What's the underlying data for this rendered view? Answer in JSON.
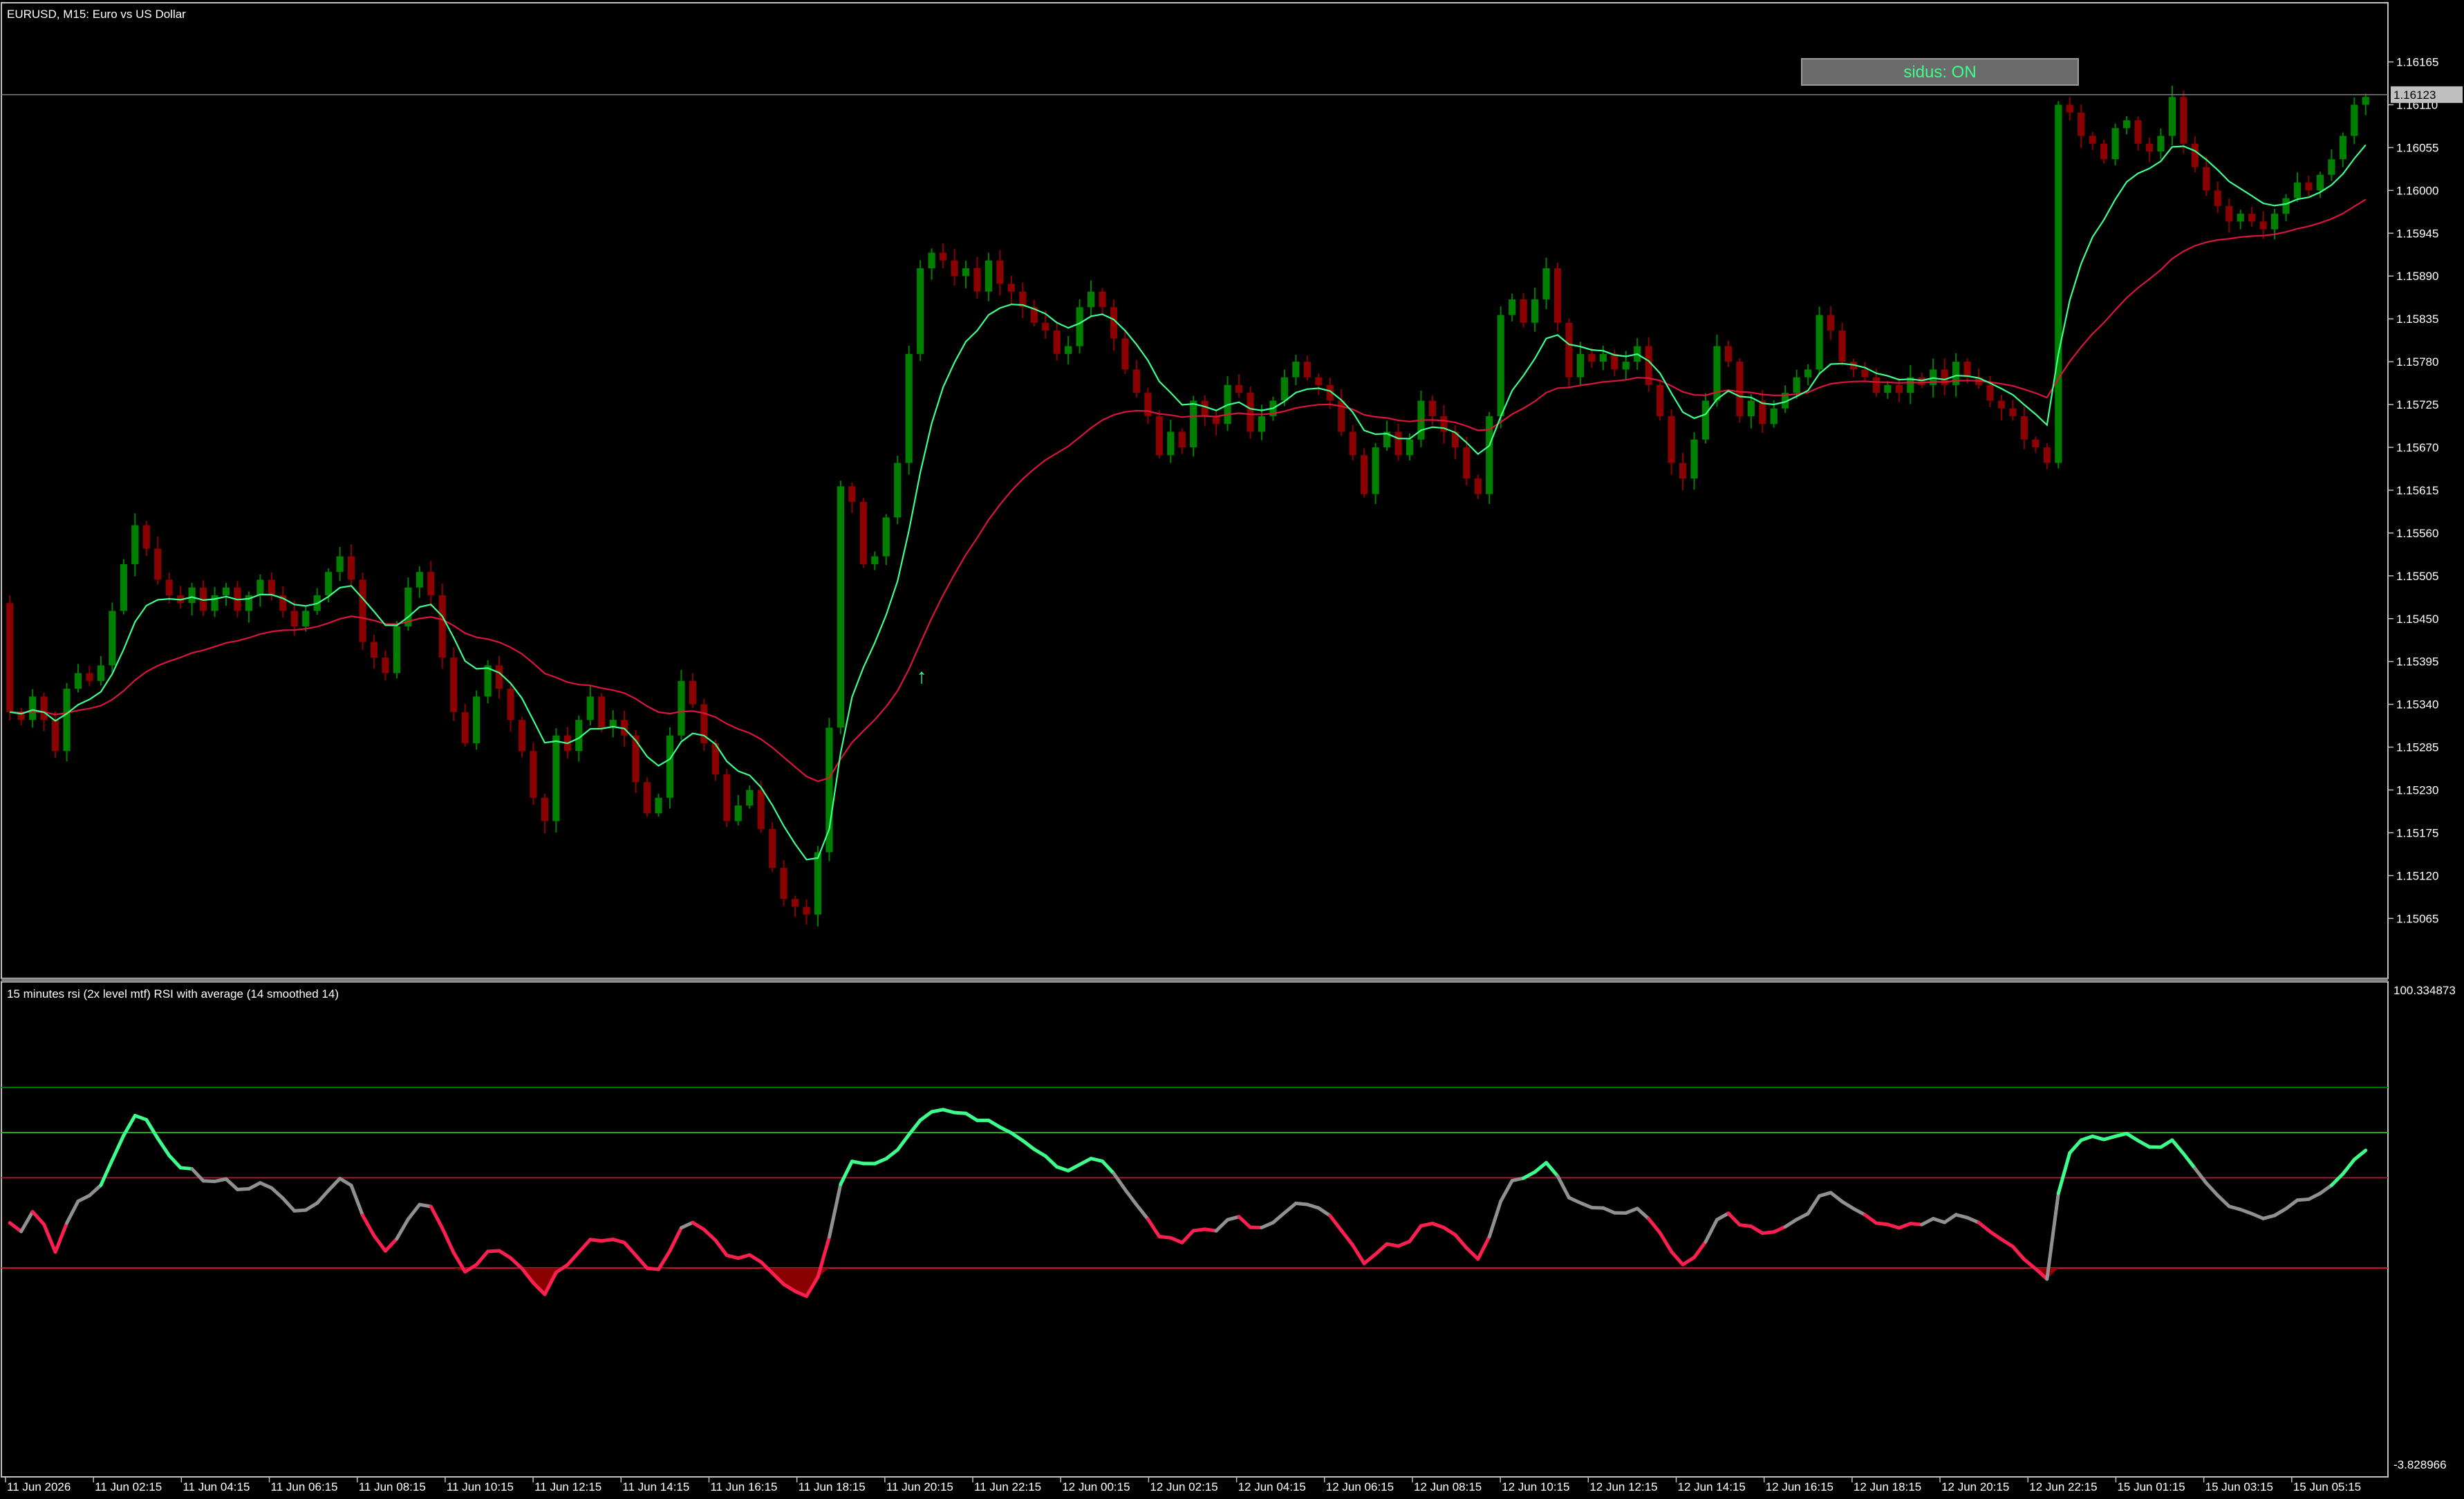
{
  "window": {
    "title": "EURUSD, M15:  Euro vs US Dollar",
    "button_label": "sidus: ON",
    "current_price": "1.16123"
  },
  "colors": {
    "background": "#000000",
    "bull_candle": "#008000",
    "bear_candle": "#8b0000",
    "fast_ma": "#3cff8c",
    "slow_ma": "#dc143c",
    "rsi_up": "#3cff8c",
    "rsi_down": "#ff1e50",
    "rsi_neutral": "#909090",
    "upper_fill": "#008000",
    "lower_fill": "#8b0000",
    "grid_text": "#ffffff"
  },
  "price_axis": {
    "labels": [
      "1.16165",
      "1.16110",
      "1.16055",
      "1.16000",
      "1.15945",
      "1.15890",
      "1.15835",
      "1.15780",
      "1.15725",
      "1.15670",
      "1.15615",
      "1.15560",
      "1.15505",
      "1.15450",
      "1.15395",
      "1.15340",
      "1.15285",
      "1.15230",
      "1.15175",
      "1.15120",
      "1.15065"
    ]
  },
  "rsi_panel": {
    "title": "15 minutes rsi (2x level mtf) RSI with average (14 smoothed 14)",
    "max_label": "100.334873",
    "min_label": "-3.828966",
    "levels": [
      80,
      70,
      60,
      40
    ]
  },
  "time_axis": {
    "labels": [
      "11 Jun 2026",
      "11 Jun 02:15",
      "11 Jun 04:15",
      "11 Jun 06:15",
      "11 Jun 08:15",
      "11 Jun 10:15",
      "11 Jun 12:15",
      "11 Jun 14:15",
      "11 Jun 16:15",
      "11 Jun 18:15",
      "11 Jun 20:15",
      "11 Jun 22:15",
      "12 Jun 00:15",
      "12 Jun 02:15",
      "12 Jun 04:15",
      "12 Jun 06:15",
      "12 Jun 08:15",
      "12 Jun 10:15",
      "12 Jun 12:15",
      "12 Jun 14:15",
      "12 Jun 16:15",
      "12 Jun 18:15",
      "12 Jun 20:15",
      "12 Jun 22:15",
      "15 Jun 01:15",
      "15 Jun 03:15",
      "15 Jun 05:15"
    ]
  },
  "chart_data": {
    "type": "candlestick",
    "symbol": "EURUSD",
    "timeframe": "M15",
    "price_range": [
      1.15028,
      1.16209
    ],
    "closes": [
      1.1533,
      1.1532,
      1.1535,
      1.1532,
      1.1528,
      1.1536,
      1.1538,
      1.1537,
      1.1539,
      1.1546,
      1.1552,
      1.1557,
      1.1554,
      1.155,
      1.1548,
      1.1547,
      1.1549,
      1.1546,
      1.1548,
      1.1549,
      1.1546,
      1.1548,
      1.155,
      1.1548,
      1.1546,
      1.1544,
      1.1546,
      1.1548,
      1.1551,
      1.1553,
      1.155,
      1.1542,
      1.154,
      1.1538,
      1.1544,
      1.1549,
      1.1551,
      1.1548,
      1.154,
      1.1533,
      1.1529,
      1.1535,
      1.1539,
      1.1536,
      1.1532,
      1.1528,
      1.1522,
      1.1519,
      1.153,
      1.1528,
      1.1532,
      1.1535,
      1.1531,
      1.1532,
      1.153,
      1.1524,
      1.152,
      1.1522,
      1.153,
      1.1537,
      1.1534,
      1.1529,
      1.1525,
      1.1519,
      1.1521,
      1.1523,
      1.1518,
      1.1513,
      1.1509,
      1.1508,
      1.1507,
      1.1515,
      1.1531,
      1.1562,
      1.156,
      1.1552,
      1.1553,
      1.1558,
      1.1565,
      1.1579,
      1.159,
      1.1592,
      1.1591,
      1.1589,
      1.159,
      1.1587,
      1.1591,
      1.1588,
      1.1587,
      1.1585,
      1.1583,
      1.1582,
      1.1579,
      1.158,
      1.1585,
      1.1587,
      1.1585,
      1.1581,
      1.1577,
      1.1574,
      1.1571,
      1.1566,
      1.1569,
      1.1567,
      1.1573,
      1.1571,
      1.157,
      1.1575,
      1.1574,
      1.1569,
      1.1571,
      1.1573,
      1.1576,
      1.1578,
      1.1576,
      1.1575,
      1.1573,
      1.1569,
      1.1566,
      1.1561,
      1.1567,
      1.1569,
      1.1566,
      1.1568,
      1.1573,
      1.1571,
      1.1569,
      1.1567,
      1.1563,
      1.1561,
      1.1571,
      1.1584,
      1.1586,
      1.1583,
      1.1586,
      1.159,
      1.1583,
      1.1576,
      1.1579,
      1.1578,
      1.1579,
      1.1577,
      1.1578,
      1.158,
      1.1575,
      1.1571,
      1.1565,
      1.1563,
      1.1568,
      1.1573,
      1.158,
      1.1578,
      1.1571,
      1.1573,
      1.157,
      1.1572,
      1.1574,
      1.1576,
      1.1577,
      1.1584,
      1.1582,
      1.1578,
      1.1577,
      1.1576,
      1.1574,
      1.1575,
      1.1574,
      1.1576,
      1.1575,
      1.1577,
      1.1575,
      1.1578,
      1.1576,
      1.1575,
      1.1573,
      1.1572,
      1.1571,
      1.1568,
      1.1567,
      1.1565,
      1.1611,
      1.161,
      1.1607,
      1.1606,
      1.1604,
      1.1608,
      1.1609,
      1.1606,
      1.1605,
      1.1607,
      1.1612,
      1.1606,
      1.1603,
      1.16,
      1.1598,
      1.1596,
      1.1597,
      1.1596,
      1.1595,
      1.1597,
      1.1599,
      1.1601,
      1.16,
      1.1602,
      1.1604,
      1.1607,
      1.1611,
      1.1612
    ]
  }
}
